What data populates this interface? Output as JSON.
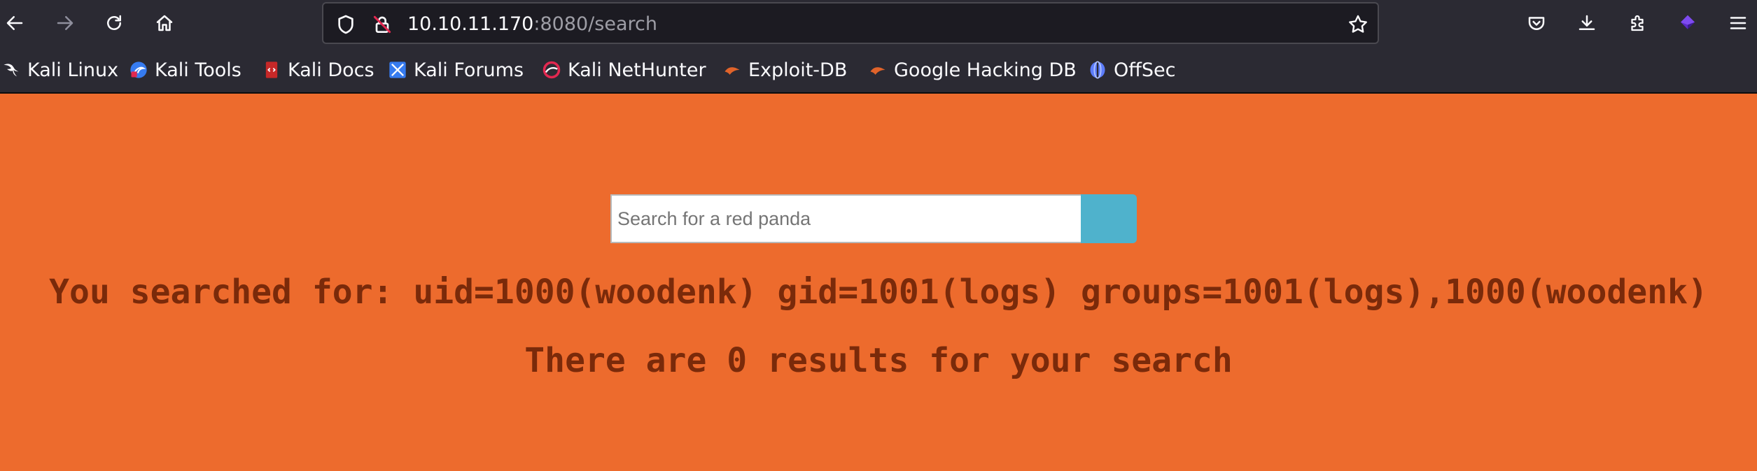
{
  "browser": {
    "url_host": "10.10.11.170",
    "url_rest": ":8080/search",
    "icons": {
      "back": "arrow-left-icon",
      "forward": "arrow-right-icon",
      "reload": "reload-icon",
      "home": "home-icon",
      "shield": "shield-icon",
      "insecure": "insecure-lock-icon",
      "star": "star-icon",
      "pocket": "pocket-icon",
      "download": "download-icon",
      "extensions": "extensions-icon",
      "profile": "profile-icon",
      "menu": "hamburger-menu-icon"
    }
  },
  "bookmarks": [
    {
      "label": "Kali Linux",
      "icon": "kali-dragon-icon"
    },
    {
      "label": "Kali Tools",
      "icon": "kali-tools-icon"
    },
    {
      "label": "Kali Docs",
      "icon": "kali-docs-icon"
    },
    {
      "label": "Kali Forums",
      "icon": "kali-forums-icon"
    },
    {
      "label": "Kali NetHunter",
      "icon": "kali-nethunter-icon"
    },
    {
      "label": "Exploit-DB",
      "icon": "exploit-db-icon"
    },
    {
      "label": "Google Hacking DB",
      "icon": "ghdb-icon"
    },
    {
      "label": "OffSec",
      "icon": "offsec-icon"
    }
  ],
  "page": {
    "search_placeholder": "Search for a red panda",
    "search_value": "",
    "searched_for": "You searched for: uid=1000(woodenk) gid=1001(logs) groups=1001(logs),1000(woodenk)",
    "results_text": "There are 0 results for your search"
  },
  "colors": {
    "page_background": "#ED6B2D",
    "text": "#7A2A0A",
    "search_button": "#4FB2CC",
    "browser_chrome": "#2B2A33"
  }
}
